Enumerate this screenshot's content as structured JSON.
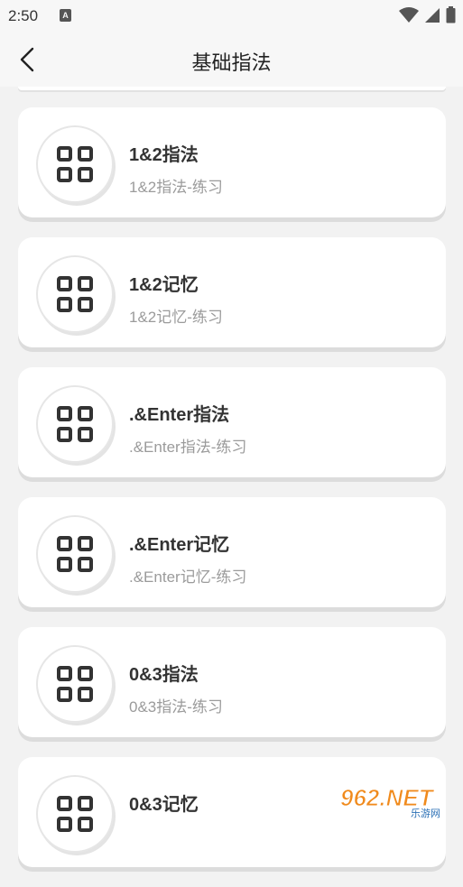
{
  "status_bar": {
    "time": "2:50",
    "notification_icon": "text-a-icon"
  },
  "app_bar": {
    "back_icon": "chevron-left-icon",
    "title": "基础指法"
  },
  "items": [
    {
      "title": "1&2指法",
      "subtitle": "1&2指法-练习",
      "icon": "grid-icon"
    },
    {
      "title": "1&2记忆",
      "subtitle": "1&2记忆-练习",
      "icon": "grid-icon"
    },
    {
      "title": ".&Enter指法",
      "subtitle": ".&Enter指法-练习",
      "icon": "grid-icon"
    },
    {
      "title": ".&Enter记忆",
      "subtitle": ".&Enter记忆-练习",
      "icon": "grid-icon"
    },
    {
      "title": "0&3指法",
      "subtitle": "0&3指法-练习",
      "icon": "grid-icon"
    },
    {
      "title": "0&3记忆",
      "subtitle": "",
      "icon": "grid-icon"
    }
  ],
  "watermark": {
    "text": "962.NET",
    "subtext": "乐游网"
  },
  "colors": {
    "background": "#f2f2f2",
    "card": "#ffffff",
    "title_text": "#333333",
    "subtitle_text": "#9b9b9b",
    "watermark_orange": "#f08a1c"
  }
}
